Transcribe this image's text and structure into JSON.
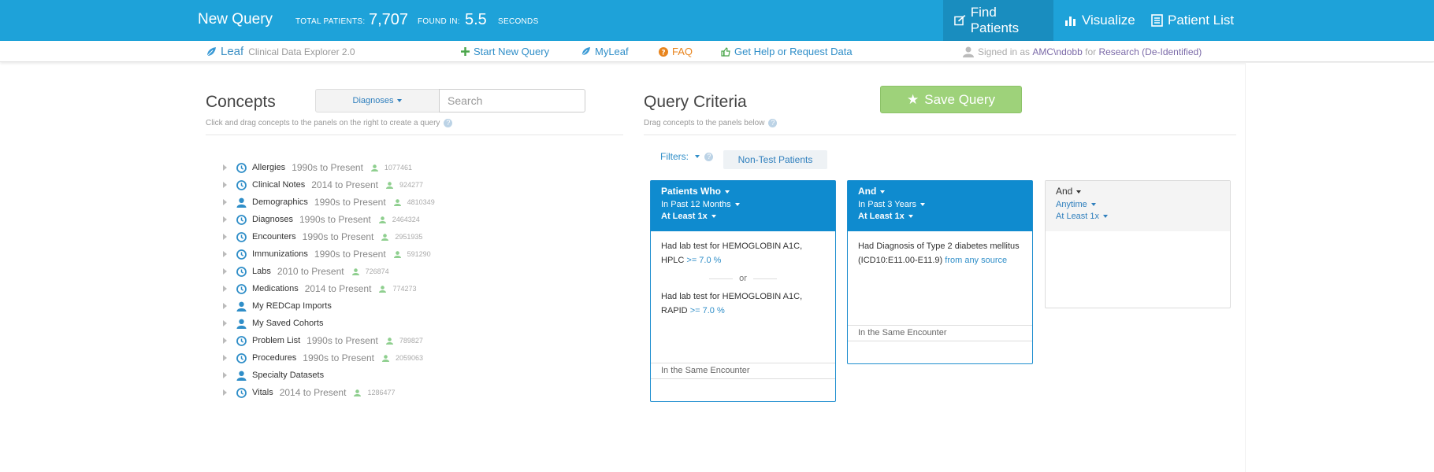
{
  "header": {
    "title": "New Query",
    "total_label": "TOTAL PATIENTS:",
    "total_value": "7,707",
    "found_label": "FOUND IN:",
    "found_value": "5.5",
    "seconds_label": "SECONDS",
    "tabs": [
      {
        "label": "Find Patients",
        "icon": "search-icon",
        "active": true
      },
      {
        "label": "Visualize",
        "icon": "bar-chart-icon",
        "active": false
      },
      {
        "label": "Patient List",
        "icon": "list-icon",
        "active": false
      }
    ],
    "accent": "#1ea2d9"
  },
  "subbar": {
    "app_name": "Leaf",
    "app_subtitle": "Clinical Data Explorer 2.0",
    "start_new": "Start New Query",
    "myleaf": "MyLeaf",
    "faq": "FAQ",
    "help": "Get Help or Request Data",
    "signed_in_as": "Signed in as",
    "user": "AMC\\ndobb",
    "for_label": "for",
    "access": "Research (De-Identified)"
  },
  "concepts": {
    "title": "Concepts",
    "hint": "Click and drag concepts to the panels on the right to create a query",
    "dropdown": "Diagnoses",
    "search_placeholder": "Search",
    "items": [
      {
        "name": "Allergies",
        "range": "1990s to Present",
        "count": "1077461",
        "icon": "clock-icon"
      },
      {
        "name": "Clinical Notes",
        "range": "2014 to Present",
        "count": "924277",
        "icon": "clock-icon"
      },
      {
        "name": "Demographics",
        "range": "1990s to Present",
        "count": "4810349",
        "icon": "person-icon"
      },
      {
        "name": "Diagnoses",
        "range": "1990s to Present",
        "count": "2464324",
        "icon": "clock-icon"
      },
      {
        "name": "Encounters",
        "range": "1990s to Present",
        "count": "2951935",
        "icon": "clock-icon"
      },
      {
        "name": "Immunizations",
        "range": "1990s to Present",
        "count": "591290",
        "icon": "clock-icon"
      },
      {
        "name": "Labs",
        "range": "2010 to Present",
        "count": "726874",
        "icon": "clock-icon"
      },
      {
        "name": "Medications",
        "range": "2014 to Present",
        "count": "774273",
        "icon": "clock-icon"
      },
      {
        "name": "My REDCap Imports",
        "range": "",
        "count": "",
        "icon": "person-icon"
      },
      {
        "name": "My Saved Cohorts",
        "range": "",
        "count": "",
        "icon": "person-icon"
      },
      {
        "name": "Problem List",
        "range": "1990s to Present",
        "count": "789827",
        "icon": "clock-icon"
      },
      {
        "name": "Procedures",
        "range": "1990s to Present",
        "count": "2059063",
        "icon": "clock-icon"
      },
      {
        "name": "Specialty Datasets",
        "range": "",
        "count": "",
        "icon": "person-icon"
      },
      {
        "name": "Vitals",
        "range": "2014 to Present",
        "count": "1286477",
        "icon": "clock-icon"
      }
    ]
  },
  "criteria": {
    "title": "Query Criteria",
    "hint": "Drag concepts to the panels below",
    "save_label": "Save Query",
    "filters_label": "Filters:",
    "filter_chip": "Non-Test Patients",
    "panels": [
      {
        "head": "Patients Who",
        "period": "In Past 12 Months",
        "count": "At Least 1x",
        "c1_text": "Had lab test for HEMOGLOBIN A1C, HPLC",
        "c1_val": ">= 7.0 %",
        "or": "or",
        "c2_text": "Had lab test for HEMOGLOBIN A1C, RAPID",
        "c2_val": ">= 7.0 %",
        "foot": "In the Same Encounter"
      },
      {
        "head": "And",
        "period": "In Past 3 Years",
        "count": "At Least 1x",
        "c1_text": "Had Diagnosis of Type 2 diabetes mellitus (ICD10:E11.00-E11.9)",
        "c1_val": "from any source",
        "foot": "In the Same Encounter"
      },
      {
        "head": "And",
        "period": "Anytime",
        "count": "At Least 1x"
      }
    ]
  }
}
